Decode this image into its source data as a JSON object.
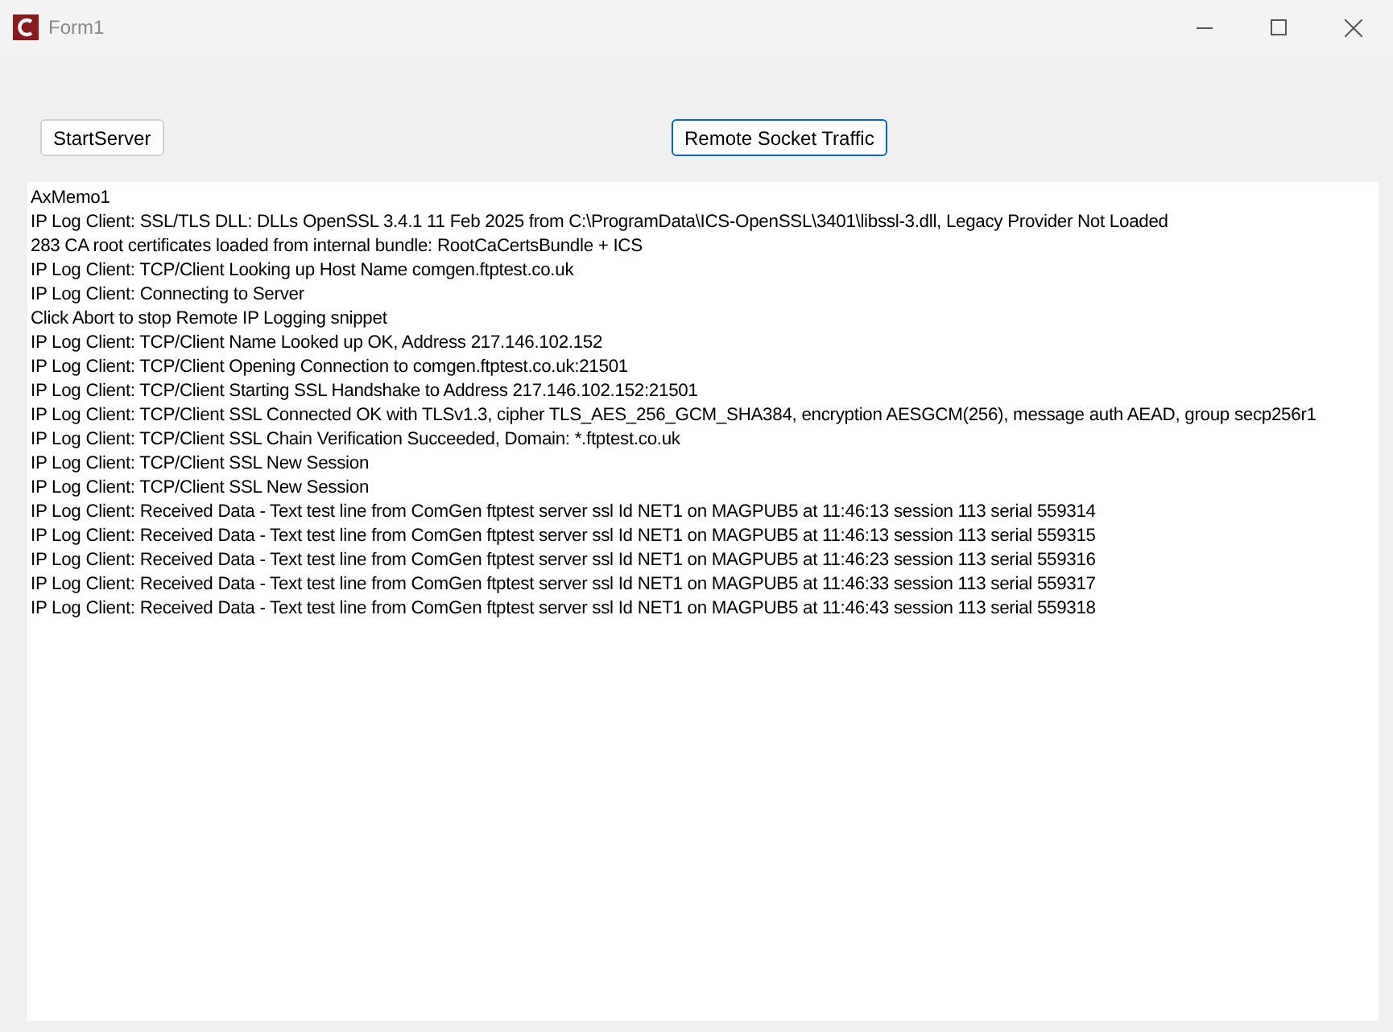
{
  "window": {
    "title": "Form1"
  },
  "buttons": [
    {
      "label": "StartServer",
      "focused": false
    },
    {
      "label": "Remote Socket Traffic",
      "focused": true
    }
  ],
  "memo": {
    "lines": [
      "AxMemo1",
      "IP Log Client: SSL/TLS DLL: DLLs OpenSSL 3.4.1 11 Feb 2025 from C:\\ProgramData\\ICS-OpenSSL\\3401\\libssl-3.dll, Legacy Provider Not Loaded",
      "283 CA root certificates loaded from internal bundle: RootCaCertsBundle + ICS",
      "IP Log Client: TCP/Client Looking up Host Name comgen.ftptest.co.uk",
      "IP Log Client: Connecting to Server",
      "Click Abort to stop Remote IP Logging snippet",
      "IP Log Client: TCP/Client Name Looked up OK, Address 217.146.102.152",
      "IP Log Client: TCP/Client Opening Connection to comgen.ftptest.co.uk:21501",
      "IP Log Client: TCP/Client Starting SSL Handshake to Address 217.146.102.152:21501",
      "IP Log Client: TCP/Client SSL Connected OK with TLSv1.3, cipher TLS_AES_256_GCM_SHA384, encryption AESGCM(256), message auth AEAD, group secp256r1",
      "IP Log Client: TCP/Client SSL Chain Verification Succeeded, Domain: *.ftptest.co.uk",
      "IP Log Client: TCP/Client SSL New Session",
      "IP Log Client: TCP/Client SSL New Session",
      "IP Log Client: Received Data - Text test line from ComGen ftptest server ssl Id NET1 on MAGPUB5 at 11:46:13 session 113 serial 559314",
      "IP Log Client: Received Data - Text test line from ComGen ftptest server ssl Id NET1 on MAGPUB5 at 11:46:13 session 113 serial 559315",
      "IP Log Client: Received Data - Text test line from ComGen ftptest server ssl Id NET1 on MAGPUB5 at 11:46:23 session 113 serial 559316",
      "IP Log Client: Received Data - Text test line from ComGen ftptest server ssl Id NET1 on MAGPUB5 at 11:46:33 session 113 serial 559317",
      "IP Log Client: Received Data - Text test line from ComGen ftptest server ssl Id NET1 on MAGPUB5 at 11:46:43 session 113 serial 559318"
    ]
  }
}
